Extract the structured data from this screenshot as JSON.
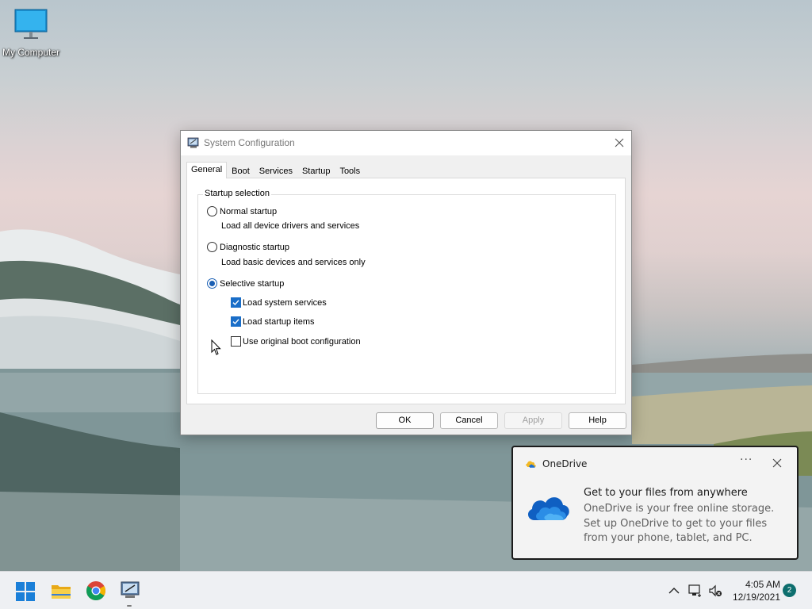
{
  "desktop": {
    "icons": [
      {
        "label": "My Computer",
        "icon": "monitor-icon"
      }
    ]
  },
  "dialog": {
    "title": "System Configuration",
    "tabs": [
      {
        "label": "General",
        "active": true
      },
      {
        "label": "Boot",
        "active": false
      },
      {
        "label": "Services",
        "active": false
      },
      {
        "label": "Startup",
        "active": false
      },
      {
        "label": "Tools",
        "active": false
      }
    ],
    "group_title": "Startup selection",
    "options": {
      "normal": {
        "label": "Normal startup",
        "desc": "Load all device drivers and services",
        "selected": false
      },
      "diagnostic": {
        "label": "Diagnostic startup",
        "desc": "Load basic devices and services only",
        "selected": false
      },
      "selective": {
        "label": "Selective startup",
        "selected": true
      }
    },
    "checkboxes": {
      "system_services": {
        "label": "Load system services",
        "checked": true
      },
      "startup_items": {
        "label": "Load startup items",
        "checked": true
      },
      "original_boot": {
        "label": "Use original boot configuration",
        "checked": false
      }
    },
    "buttons": {
      "ok": "OK",
      "cancel": "Cancel",
      "apply": "Apply",
      "help": "Help"
    }
  },
  "toast": {
    "app": "OneDrive",
    "more": "···",
    "title": "Get to your files from anywhere",
    "body": "OneDrive is your free online storage. Set up OneDrive to get to your files from your phone, tablet, and PC."
  },
  "taskbar": {
    "apps": [
      "windows-start-icon",
      "file-explorer-icon",
      "chrome-icon",
      "system-configuration-icon"
    ],
    "time": "4:05 AM",
    "date": "12/19/2021",
    "notifications": "2"
  },
  "colors": {
    "accent": "#1a6ec8",
    "toast_bg": "#f3f3f3",
    "taskbar_bg": "#eef0f3",
    "badge": "#0d6e6e"
  }
}
